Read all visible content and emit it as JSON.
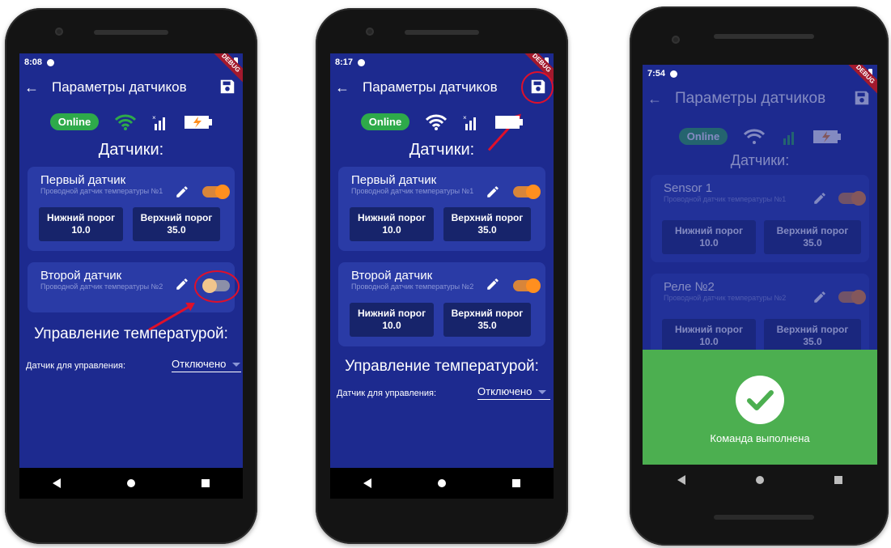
{
  "phones": [
    {
      "status": {
        "time": "8:08"
      },
      "appbar": {
        "title": "Параметры датчиков"
      },
      "online_label": "Online",
      "sensors_title": "Датчики:",
      "sensors": [
        {
          "name": "Первый датчик",
          "desc": "Проводной датчик температуры №1",
          "toggle": "on",
          "low_label": "Нижний порог",
          "low": "10.0",
          "high_label": "Верхний порог",
          "high": "35.0"
        },
        {
          "name": "Второй датчик",
          "desc": "Проводной датчик температуры №2",
          "toggle": "off"
        }
      ],
      "control_title": "Управление температурой:",
      "control_label": "Датчик для управления:",
      "control_value": "Отключено"
    },
    {
      "status": {
        "time": "8:17"
      },
      "appbar": {
        "title": "Параметры датчиков"
      },
      "online_label": "Online",
      "sensors_title": "Датчики:",
      "sensors": [
        {
          "name": "Первый датчик",
          "desc": "Проводной датчик температуры №1",
          "toggle": "on",
          "low_label": "Нижний порог",
          "low": "10.0",
          "high_label": "Верхний порог",
          "high": "35.0"
        },
        {
          "name": "Второй датчик",
          "desc": "Проводной датчик температуры №2",
          "toggle": "on",
          "low_label": "Нижний порог",
          "low": "10.0",
          "high_label": "Верхний порог",
          "high": "35.0"
        }
      ],
      "control_title": "Управление температурой:",
      "control_label": "Датчик для управления:",
      "control_value": "Отключено"
    },
    {
      "status": {
        "time": "7:54"
      },
      "appbar": {
        "title": "Параметры датчиков"
      },
      "online_label": "Online",
      "sensors_title": "Датчики:",
      "sensors": [
        {
          "name": "Sensor 1",
          "desc": "Проводной датчик температуры №1",
          "toggle": "on",
          "low_label": "Нижний порог",
          "low": "10.0",
          "high_label": "Верхний порог",
          "high": "35.0"
        },
        {
          "name": "Реле №2",
          "desc": "Проводной датчик температуры №2",
          "toggle": "on",
          "low_label": "Нижний порог",
          "low": "10.0",
          "high_label": "Верхний порог",
          "high": "35.0"
        }
      ],
      "toast": {
        "message": "Команда выполнена"
      }
    }
  ],
  "debug_label": "DEBUG",
  "colors": {
    "background": "#1d2a8f",
    "card": "#2a3ba6",
    "threshold_box": "#17246b",
    "online": "#2eaa4a",
    "toggle_on": "#ff8f1f",
    "toast": "#4caf50",
    "annotation": "#e0102a"
  },
  "icons": [
    "back-arrow-icon",
    "save-icon",
    "wifi-icon",
    "signal-icon",
    "battery-charging-icon",
    "pencil-icon",
    "dropdown-arrow-icon",
    "check-icon",
    "nav-back-icon",
    "nav-home-icon",
    "nav-recent-icon"
  ]
}
